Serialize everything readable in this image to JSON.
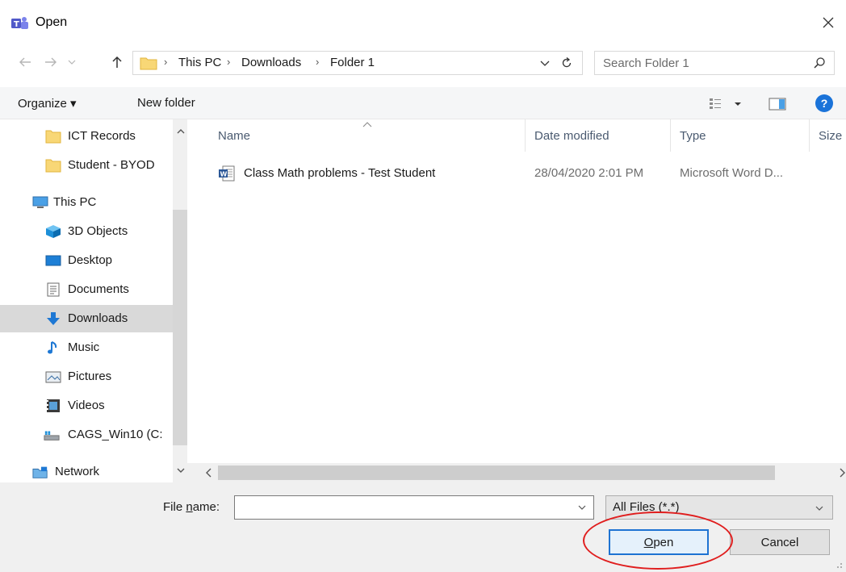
{
  "window": {
    "title": "Open",
    "close_label": "×"
  },
  "address": {
    "crumbs": [
      "This PC",
      "Downloads",
      "Folder 1"
    ],
    "separator": "›"
  },
  "search": {
    "placeholder": "Search Folder 1"
  },
  "toolbar": {
    "organize": "Organize ▾",
    "new_folder": "New folder",
    "help": "?"
  },
  "nav": {
    "items": [
      {
        "label": "ICT Records",
        "icon": "folder-icon"
      },
      {
        "label": "Student - BYOD",
        "icon": "folder-icon"
      },
      {
        "label": "This PC",
        "icon": "computer-icon"
      },
      {
        "label": "3D Objects",
        "icon": "3d-objects-icon"
      },
      {
        "label": "Desktop",
        "icon": "desktop-icon"
      },
      {
        "label": "Documents",
        "icon": "documents-icon"
      },
      {
        "label": "Downloads",
        "icon": "downloads-icon",
        "selected": true
      },
      {
        "label": "Music",
        "icon": "music-icon"
      },
      {
        "label": "Pictures",
        "icon": "pictures-icon"
      },
      {
        "label": "Videos",
        "icon": "videos-icon"
      },
      {
        "label": "CAGS_Win10 (C:",
        "icon": "drive-icon"
      },
      {
        "label": "Network",
        "icon": "network-icon"
      }
    ]
  },
  "columns": {
    "name": "Name",
    "date": "Date modified",
    "type": "Type",
    "size": "Size"
  },
  "files": [
    {
      "name": "Class Math problems - Test Student",
      "date": "28/04/2020 2:01 PM",
      "type": "Microsoft Word D...",
      "icon": "word-document-icon"
    }
  ],
  "bottom": {
    "file_name_label_pre": "File ",
    "file_name_label_u": "n",
    "file_name_label_post": "ame:",
    "file_name_value": "",
    "file_type": "All Files (*.*)",
    "open_u": "O",
    "open_rest": "pen",
    "cancel": "Cancel"
  },
  "colors": {
    "accent": "#1e73d2",
    "highlight": "#e01e1e",
    "selected_bg": "#d9d9d9"
  }
}
